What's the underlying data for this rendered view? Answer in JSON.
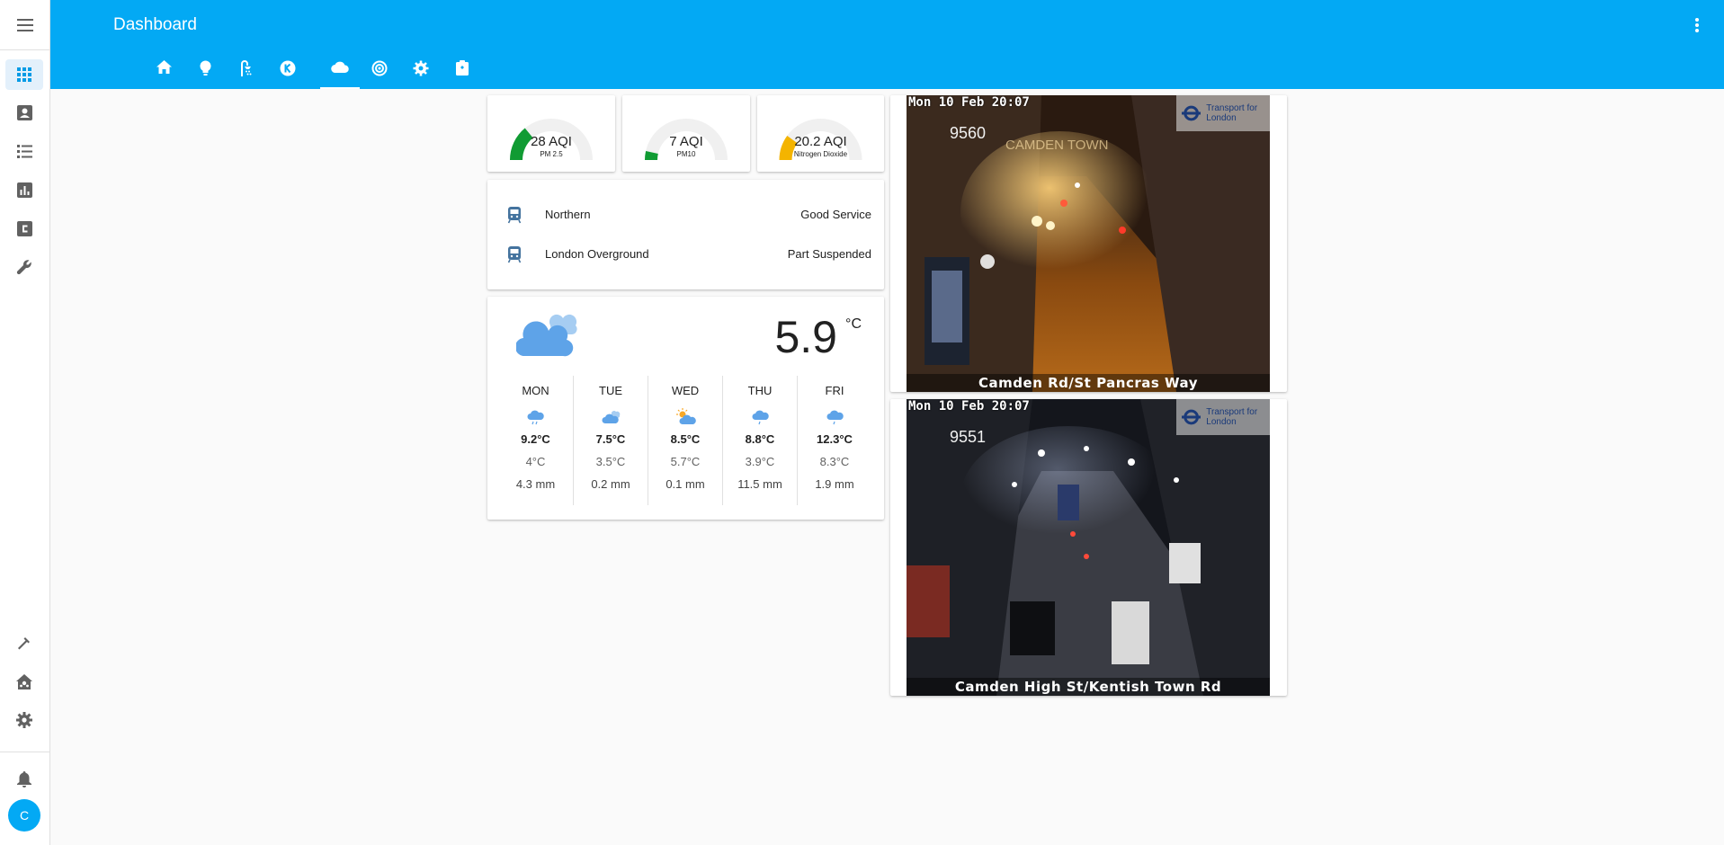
{
  "app": {
    "title": "Dashboard",
    "user_initial": "C"
  },
  "sidebar": {
    "items": [
      {
        "name": "dashboard",
        "icon": "view-dashboard-icon",
        "active": true
      },
      {
        "name": "map",
        "icon": "account-box-icon"
      },
      {
        "name": "logbook",
        "icon": "format-list-bulleted-icon"
      },
      {
        "name": "history",
        "icon": "chart-box-icon"
      },
      {
        "name": "hacs",
        "icon": "alpha-c-box-icon"
      },
      {
        "name": "tools",
        "icon": "wrench-icon"
      }
    ],
    "bottom": [
      {
        "name": "developer-tools",
        "icon": "hammer-icon"
      },
      {
        "name": "supervisor",
        "icon": "home-assistant-icon"
      },
      {
        "name": "settings",
        "icon": "cog-icon"
      },
      {
        "name": "notifications",
        "icon": "bell-icon"
      }
    ]
  },
  "tabs": [
    {
      "name": "home",
      "icon": "home-icon"
    },
    {
      "name": "lights",
      "icon": "lightbulb-icon"
    },
    {
      "name": "bath",
      "icon": "shower-icon"
    },
    {
      "name": "kodi",
      "icon": "kodi-icon"
    },
    {
      "name": "weather",
      "icon": "cloud-icon",
      "active": true
    },
    {
      "name": "network",
      "icon": "radar-icon"
    },
    {
      "name": "system",
      "icon": "cog-gear-icon"
    },
    {
      "name": "tasks",
      "icon": "clipboard-icon"
    }
  ],
  "air_quality": [
    {
      "value": "28 AQI",
      "label": "PM 2.5",
      "fraction": 0.28,
      "color": "#109b33"
    },
    {
      "value": "7 AQI",
      "label": "PM10",
      "fraction": 0.07,
      "color": "#109b33"
    },
    {
      "value": "20.2 AQI",
      "label": "Nitrogen Dioxide",
      "fraction": 0.2,
      "color": "#f4b400"
    }
  ],
  "tfl": [
    {
      "line": "Northern",
      "status": "Good Service"
    },
    {
      "line": "London Overground",
      "status": "Part Suspended"
    }
  ],
  "weather": {
    "temperature": "5.9",
    "unit": "°C",
    "condition_icon": "cloudy-icon",
    "forecast": [
      {
        "day": "MON",
        "icon": "rain-icon",
        "high": "9.2°C",
        "low": "4°C",
        "precip": "4.3 mm"
      },
      {
        "day": "TUE",
        "icon": "cloudy-icon",
        "high": "7.5°C",
        "low": "3.5°C",
        "precip": "0.2 mm"
      },
      {
        "day": "WED",
        "icon": "partly-sunny-icon",
        "high": "8.5°C",
        "low": "5.7°C",
        "precip": "0.1 mm"
      },
      {
        "day": "THU",
        "icon": "rain-icon",
        "high": "8.8°C",
        "low": "3.9°C",
        "precip": "11.5 mm"
      },
      {
        "day": "FRI",
        "icon": "rain-icon",
        "high": "12.3°C",
        "low": "8.3°C",
        "precip": "1.9 mm"
      }
    ]
  },
  "cameras": [
    {
      "timestamp": "Mon 10 Feb 20:07",
      "id": "9560",
      "caption": "Camden Rd/St Pancras Way",
      "logo": "Transport for London"
    },
    {
      "timestamp": "Mon 10 Feb 20:07",
      "id": "9551",
      "caption": "Camden High St/Kentish Town Rd",
      "logo": "Transport for London"
    }
  ]
}
